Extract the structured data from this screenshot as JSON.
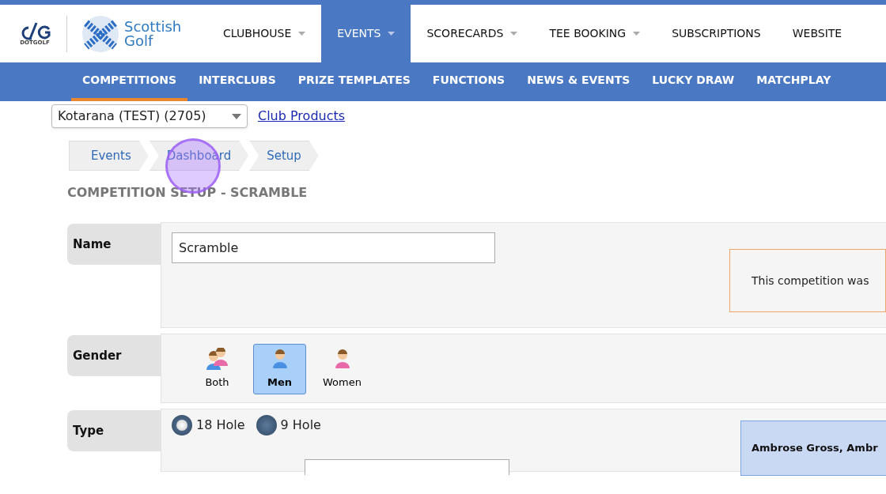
{
  "logos": {
    "dotgolf": "DOTGOLF",
    "scottish_golf": [
      "Scottish",
      "Golf"
    ]
  },
  "main_nav": [
    {
      "label": "CLUBHOUSE",
      "dropdown": true,
      "selected": false
    },
    {
      "label": "EVENTS",
      "dropdown": true,
      "selected": true
    },
    {
      "label": "SCORECARDS",
      "dropdown": true,
      "selected": false
    },
    {
      "label": "TEE BOOKING",
      "dropdown": true,
      "selected": false
    },
    {
      "label": "SUBSCRIPTIONS",
      "dropdown": false,
      "selected": false
    },
    {
      "label": "WEBSITE",
      "dropdown": false,
      "selected": false
    }
  ],
  "sub_nav": [
    {
      "label": "COMPETITIONS",
      "selected": true
    },
    {
      "label": "INTERCLUBS",
      "selected": false
    },
    {
      "label": "PRIZE TEMPLATES",
      "selected": false
    },
    {
      "label": "FUNCTIONS",
      "selected": false
    },
    {
      "label": "NEWS & EVENTS",
      "selected": false
    },
    {
      "label": "LUCKY DRAW",
      "selected": false
    },
    {
      "label": "MATCHPLAY",
      "selected": false
    }
  ],
  "club_select": {
    "value": "Kotarana (TEST) (2705)"
  },
  "club_link": "Club Products",
  "breadcrumbs": [
    "Events",
    "Dashboard",
    "Setup"
  ],
  "page_title": "COMPETITION SETUP - SCRAMBLE",
  "form": {
    "name": {
      "label": "Name",
      "value": "Scramble",
      "notice": "This competition was"
    },
    "gender": {
      "label": "Gender",
      "options": [
        {
          "label": "Both",
          "kind": "both",
          "selected": false
        },
        {
          "label": "Men",
          "kind": "men",
          "selected": true
        },
        {
          "label": "Women",
          "kind": "women",
          "selected": false
        }
      ]
    },
    "type": {
      "label": "Type",
      "options": [
        {
          "label": "18 Hole",
          "selected": true
        },
        {
          "label": "9 Hole",
          "selected": false
        }
      ],
      "info": "Ambrose Gross, Ambr"
    }
  }
}
